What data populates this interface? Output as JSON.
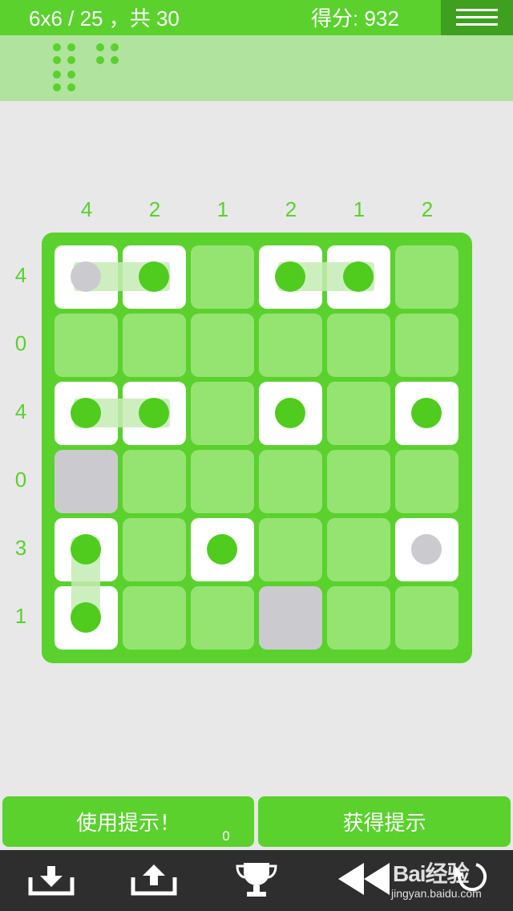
{
  "header": {
    "level_info": "6x6 / 25 ，共 30",
    "score": "得分: 932"
  },
  "puzzle": {
    "column_clues": [
      "4",
      "2",
      "1",
      "2",
      "1",
      "2"
    ],
    "row_clues": [
      "4",
      "0",
      "4",
      "0",
      "3",
      "1"
    ],
    "grid": [
      [
        "S",
        "S",
        "E",
        "S",
        "S",
        "E"
      ],
      [
        "E",
        "E",
        "E",
        "E",
        "E",
        "E"
      ],
      [
        "S",
        "S",
        "E",
        "S",
        "E",
        "S"
      ],
      [
        "W",
        "E",
        "E",
        "E",
        "E",
        "E"
      ],
      [
        "S",
        "E",
        "S",
        "E",
        "E",
        "S"
      ],
      [
        "S",
        "E",
        "E",
        "W",
        "E",
        "E"
      ]
    ],
    "grey_pegs": [
      [
        0,
        0
      ],
      [
        4,
        5
      ]
    ]
  },
  "buttons": {
    "use_hint": "使用提示！",
    "hint_count": "0",
    "get_hint": "获得提示"
  },
  "toolbar": [
    "download-icon",
    "upload-icon",
    "trophy-icon",
    "rewind-icon",
    "restart-icon"
  ],
  "watermark": {
    "main": "Bai经验",
    "sub": "jingyan.baidu.com"
  },
  "colors": {
    "accent": "#5ad12d",
    "dark_accent": "#3f9f1f",
    "cell_empty": "#95e472",
    "water": "#cbcbcf",
    "toolbar": "#2e2e2e"
  }
}
